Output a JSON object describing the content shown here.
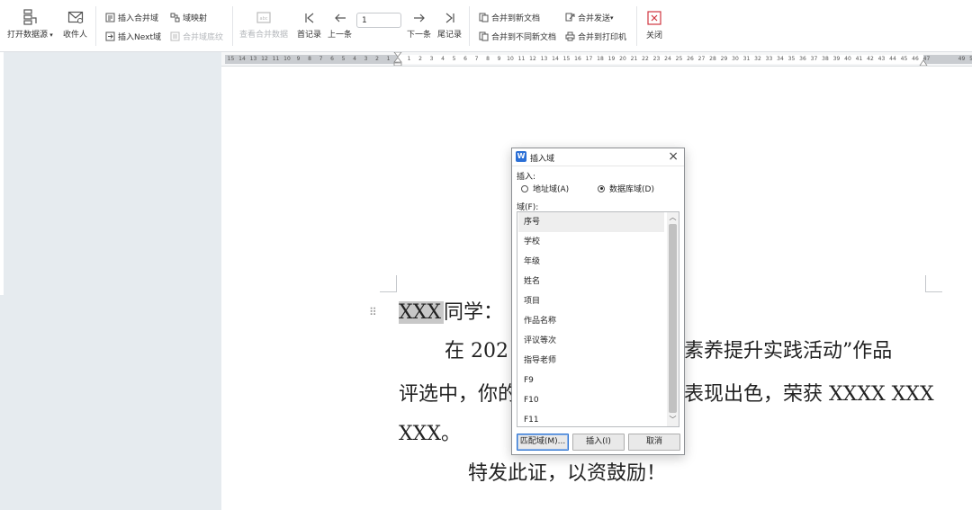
{
  "toolbar": {
    "open_source": "打开数据源",
    "recipients": "收件人",
    "insert_merge_field": "插入合并域",
    "field_mapping": "域映射",
    "insert_next_field": "插入Next域",
    "merge_field_check": "合并域底纹",
    "view_merged": "查看合并数据",
    "first_record": "首记录",
    "prev_record": "上一条",
    "record_number": "1",
    "next_record": "下一条",
    "last_record": "尾记录",
    "merge_new_doc": "合并到新文档",
    "merge_diff_doc": "合并到不同新文档",
    "merge_send": "合并发送",
    "merge_printer": "合并到打印机",
    "close": "关闭"
  },
  "ruler": {
    "left_numbers": [
      "15",
      "14",
      "13",
      "12",
      "11",
      "10",
      "9",
      "8",
      "7",
      "6",
      "5",
      "4",
      "3",
      "2",
      "1"
    ],
    "right_numbers": [
      "1",
      "2",
      "3",
      "4",
      "5",
      "6",
      "7",
      "8",
      "9",
      "10",
      "11",
      "12",
      "13",
      "14",
      "15",
      "16",
      "17",
      "18",
      "19",
      "20",
      "21",
      "22",
      "23",
      "24",
      "25",
      "26",
      "27",
      "28",
      "29",
      "30",
      "31",
      "32",
      "33",
      "34",
      "35",
      "36",
      "37",
      "38",
      "39",
      "40",
      "41",
      "42",
      "43",
      "44",
      "45",
      "46",
      "47"
    ],
    "overflow_numbers": [
      "49",
      "50",
      "51",
      "52"
    ]
  },
  "document": {
    "placeholder": "XXX",
    "greeting": "同学：",
    "line2_start": "在 202",
    "line2_end": "素养提升实践活动”作品",
    "line3_start": "评选中，你的",
    "line3_end": "表现出色，荣获 XXXX XXX",
    "line4": "XXX。",
    "line5": "特发此证，以资鼓励！"
  },
  "dialog": {
    "logo": "W",
    "title": "插入域",
    "insert_label": "插入:",
    "radio_address": "地址域(A)",
    "radio_database": "数据库域(D)",
    "field_label": "域(F):",
    "fields": [
      "序号",
      "学校",
      "年级",
      "姓名",
      "项目",
      "作品名称",
      "评议等次",
      "指导老师",
      "F9",
      "F10",
      "F11"
    ],
    "btn_match": "匹配域(M)...",
    "btn_insert": "插入(I)",
    "btn_cancel": "取消"
  },
  "colors": {
    "accent": "#2b6fd6",
    "highlight": "#c8c8c8",
    "sidebar": "#e6ebef",
    "disabled_text": "#b5b8bc"
  }
}
